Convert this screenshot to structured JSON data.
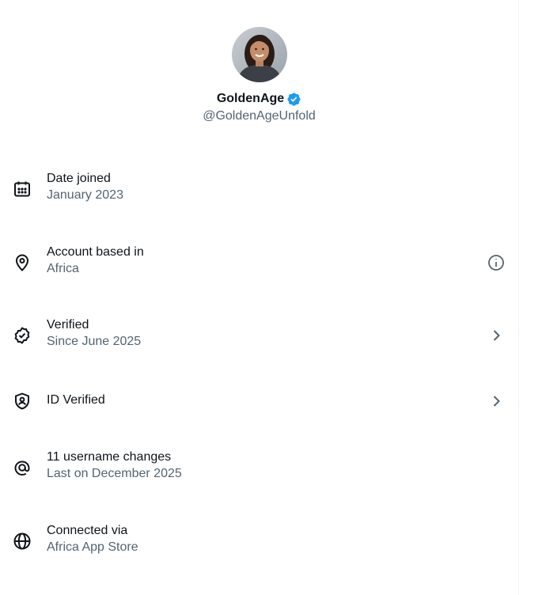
{
  "profile": {
    "display_name": "GoldenAge",
    "handle": "@GoldenAgeUnfold",
    "verified": true,
    "avatar": "woman-portrait-avatar",
    "badge_color": "#1d9bf0"
  },
  "details": [
    {
      "icon": "calendar-icon",
      "label": "Date joined",
      "value": "January 2023",
      "trailing": null
    },
    {
      "icon": "location-pin-icon",
      "label": "Account based in",
      "value": "Africa",
      "trailing": "info-icon"
    },
    {
      "icon": "verified-seal-icon",
      "label": "Verified",
      "value": "Since June 2025",
      "trailing": "chevron-right-icon"
    },
    {
      "icon": "id-shield-icon",
      "label": "ID Verified",
      "value": "",
      "trailing": "chevron-right-icon"
    },
    {
      "icon": "at-sign-icon",
      "label": "11 username changes",
      "value": "Last on December 2025",
      "trailing": null
    },
    {
      "icon": "globe-icon",
      "label": "Connected via",
      "value": "Africa App Store",
      "trailing": null
    }
  ],
  "colors": {
    "text_primary": "#0f1419",
    "text_secondary": "#536471",
    "accent": "#1d9bf0"
  }
}
